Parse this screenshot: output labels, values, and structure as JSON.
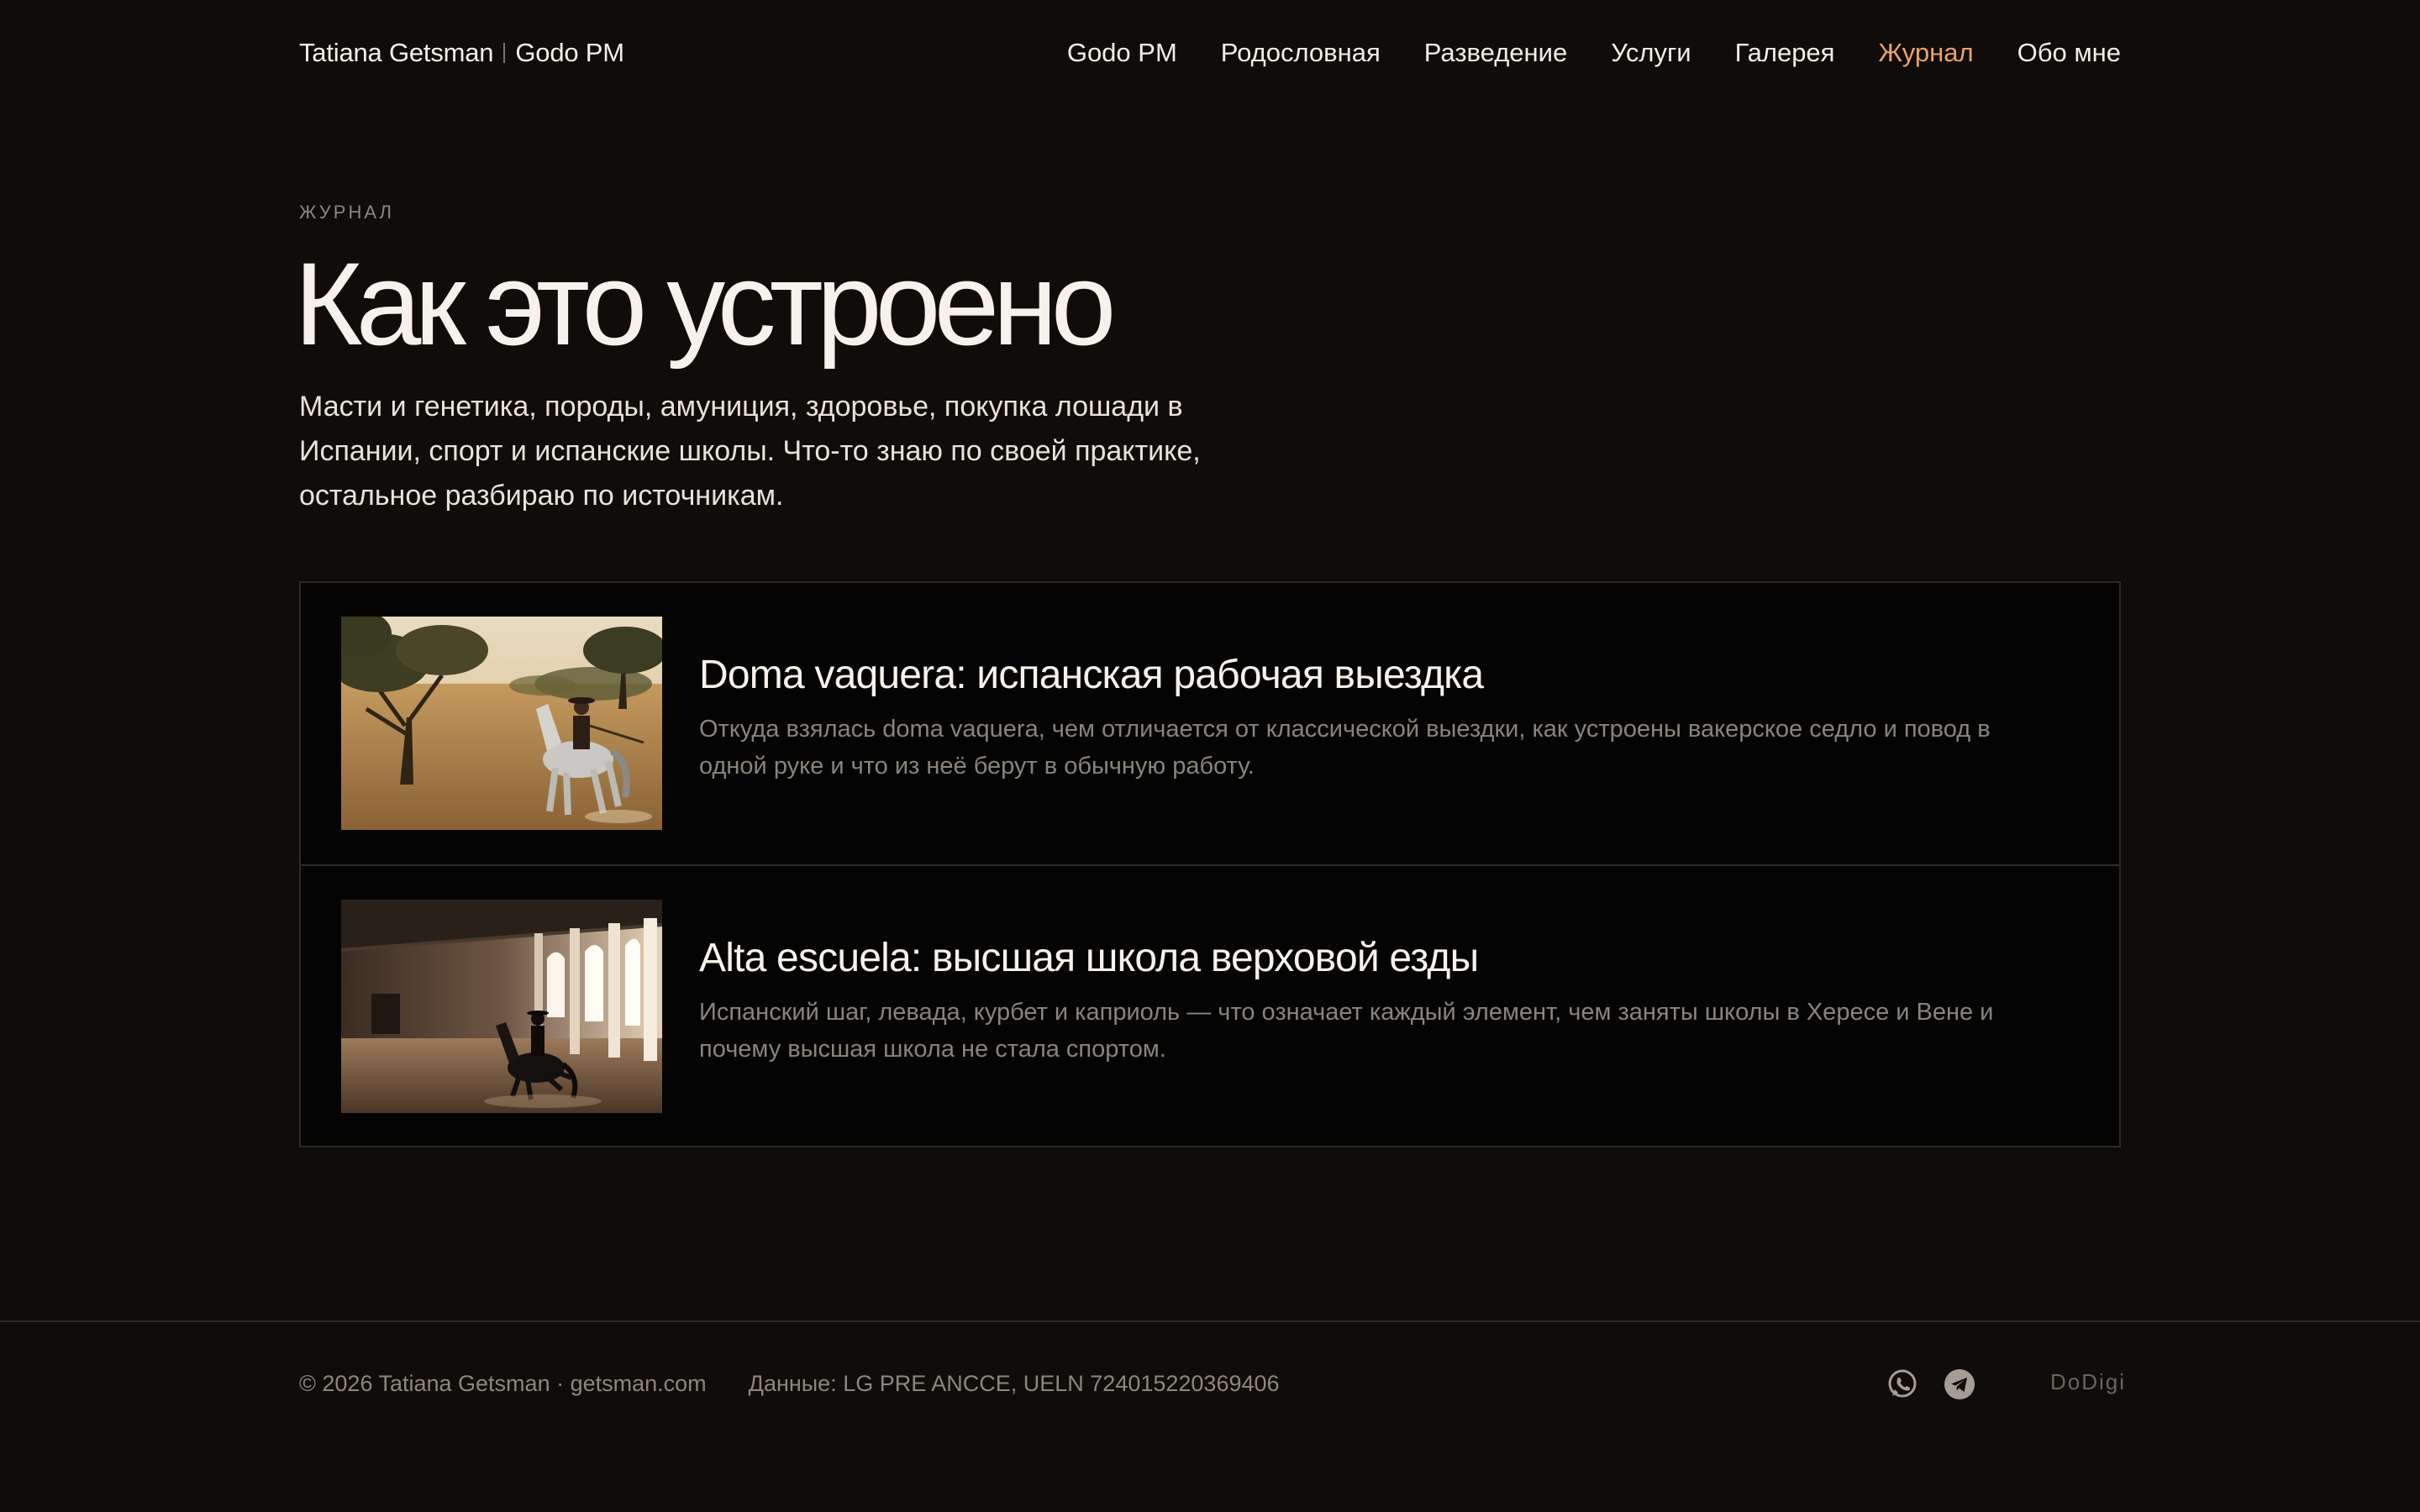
{
  "header": {
    "brand_name": "Tatiana Getsman",
    "brand_sub": "Godo PM",
    "nav": [
      {
        "label": "Godo PM"
      },
      {
        "label": "Родословная"
      },
      {
        "label": "Разведение"
      },
      {
        "label": "Услуги"
      },
      {
        "label": "Галерея"
      },
      {
        "label": "Журнал",
        "active": true
      },
      {
        "label": "Обо мне"
      }
    ],
    "active_color": "#e9a36b"
  },
  "hero": {
    "eyebrow": "ЖУРНАЛ",
    "title": "Как это устроено",
    "lead": "Масти и генетика, породы, амуниция, здоровье, покупка лошади в Испании, спорт и испанские школы. Что-то знаю по своей практике, остальное разбираю по источникам."
  },
  "articles": [
    {
      "title": "Doma vaquera: испанская рабочая выездка",
      "description": "Откуда взялась doma vaquera, чем отличается от классической выездки, как устроены вакерское седло и повод в одной руке и что из неё берут в обычную работу.",
      "image": "rider-on-grey-horse-in-field-photo"
    },
    {
      "title": "Alta escuela: высшая школа верховой езды",
      "description": "Испанский шаг, левада, курбет и каприоль — что означает каждый элемент, чем заняты школы в Хересе и Вене и почему высшая школа не стала спортом.",
      "image": "rider-in-indoor-arena-photo"
    }
  ],
  "footer": {
    "copyright": "© 2026 Tatiana Getsman · getsman.com",
    "data_note": "Данные: LG PRE ANCCE, UELN 724015220369406",
    "socials": [
      "whatsapp-icon",
      "telegram-icon"
    ],
    "maker": "DoDigi"
  }
}
